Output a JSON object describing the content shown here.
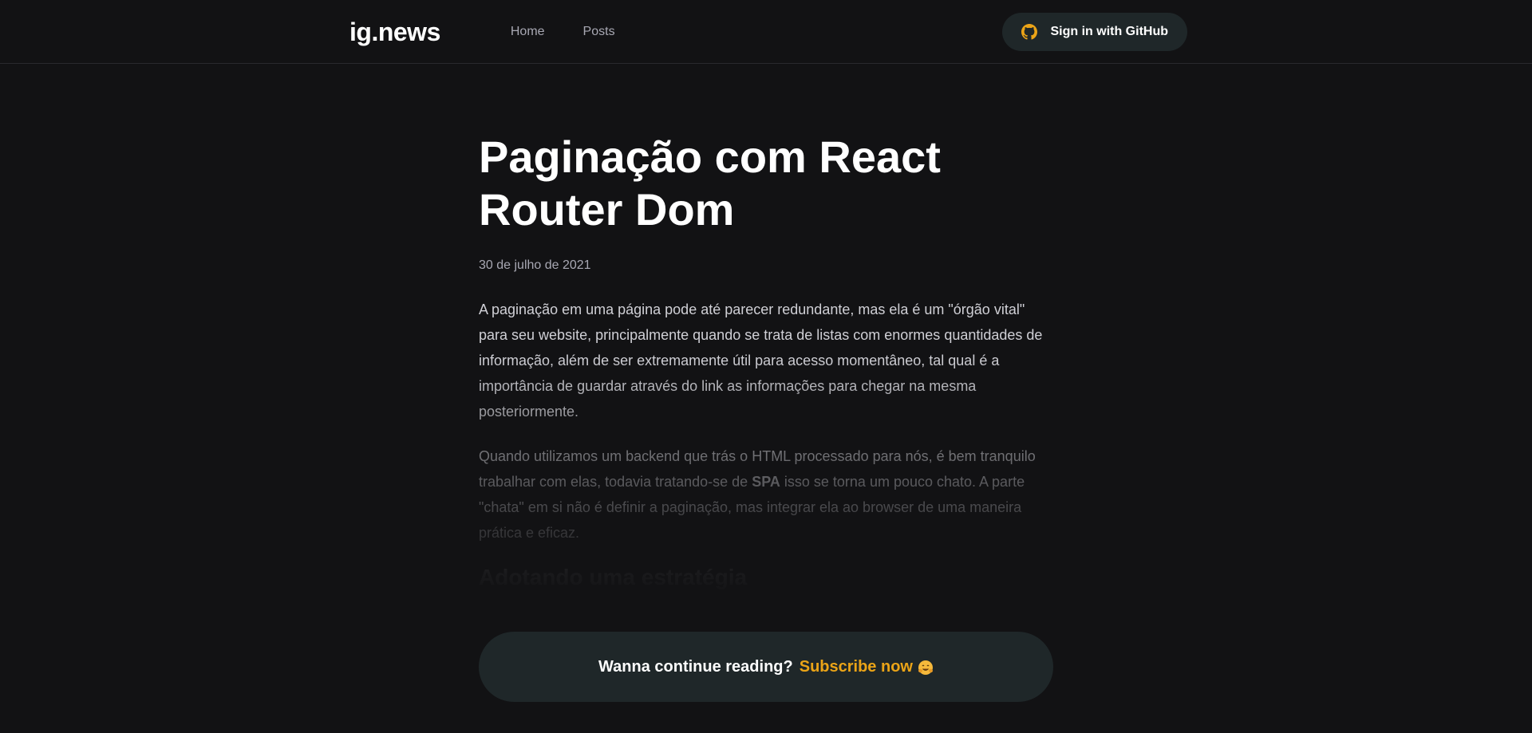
{
  "header": {
    "logo": "ig.news",
    "nav": [
      {
        "label": "Home"
      },
      {
        "label": "Posts"
      }
    ],
    "signin_label": "Sign in with GitHub"
  },
  "article": {
    "title": "Paginação com React Router Dom",
    "date": "30 de julho de 2021",
    "paragraphs": [
      "A paginação em uma página pode até parecer redundante, mas ela é um \"órgão vital\" para seu website, principalmente quando se trata de listas com enormes quantidades de informação, além de ser extremamente útil para acesso momentâneo, tal qual é a importância de guardar através do link as informações para chegar na mesma posteriormente."
    ],
    "paragraph2": {
      "before": "Quando utilizamos um backend que trás o HTML processado para nós, é bem tranquilo trabalhar com elas, todavia tratando-se de ",
      "strong": "SPA",
      "after": " isso se torna um pouco chato. A parte \"chata\" em si não é definir a paginação, mas integrar ela ao browser de uma maneira prática e eficaz."
    },
    "heading": "Adotando uma estratégia"
  },
  "cta": {
    "text": "Wanna continue reading?",
    "link": "Subscribe now"
  },
  "colors": {
    "background": "#121214",
    "accent": "#eba417",
    "surface": "#1f2729"
  },
  "icons": {
    "github": "github-icon",
    "hugging_face": "hugging-face-emoji-icon"
  }
}
